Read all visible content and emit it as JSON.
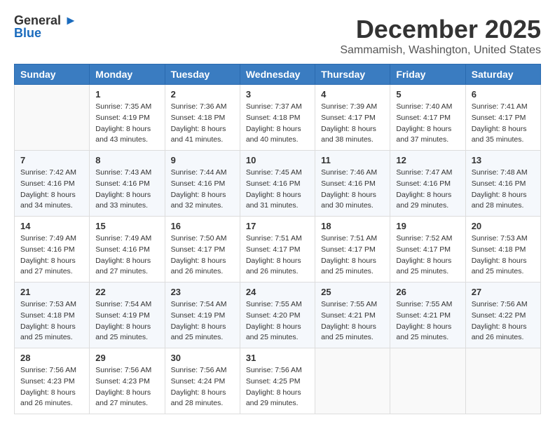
{
  "logo": {
    "general": "General",
    "blue": "Blue"
  },
  "title": "December 2025",
  "location": "Sammamish, Washington, United States",
  "days_of_week": [
    "Sunday",
    "Monday",
    "Tuesday",
    "Wednesday",
    "Thursday",
    "Friday",
    "Saturday"
  ],
  "weeks": [
    [
      {
        "day": "",
        "info": ""
      },
      {
        "day": "1",
        "info": "Sunrise: 7:35 AM\nSunset: 4:19 PM\nDaylight: 8 hours\nand 43 minutes."
      },
      {
        "day": "2",
        "info": "Sunrise: 7:36 AM\nSunset: 4:18 PM\nDaylight: 8 hours\nand 41 minutes."
      },
      {
        "day": "3",
        "info": "Sunrise: 7:37 AM\nSunset: 4:18 PM\nDaylight: 8 hours\nand 40 minutes."
      },
      {
        "day": "4",
        "info": "Sunrise: 7:39 AM\nSunset: 4:17 PM\nDaylight: 8 hours\nand 38 minutes."
      },
      {
        "day": "5",
        "info": "Sunrise: 7:40 AM\nSunset: 4:17 PM\nDaylight: 8 hours\nand 37 minutes."
      },
      {
        "day": "6",
        "info": "Sunrise: 7:41 AM\nSunset: 4:17 PM\nDaylight: 8 hours\nand 35 minutes."
      }
    ],
    [
      {
        "day": "7",
        "info": "Sunrise: 7:42 AM\nSunset: 4:16 PM\nDaylight: 8 hours\nand 34 minutes."
      },
      {
        "day": "8",
        "info": "Sunrise: 7:43 AM\nSunset: 4:16 PM\nDaylight: 8 hours\nand 33 minutes."
      },
      {
        "day": "9",
        "info": "Sunrise: 7:44 AM\nSunset: 4:16 PM\nDaylight: 8 hours\nand 32 minutes."
      },
      {
        "day": "10",
        "info": "Sunrise: 7:45 AM\nSunset: 4:16 PM\nDaylight: 8 hours\nand 31 minutes."
      },
      {
        "day": "11",
        "info": "Sunrise: 7:46 AM\nSunset: 4:16 PM\nDaylight: 8 hours\nand 30 minutes."
      },
      {
        "day": "12",
        "info": "Sunrise: 7:47 AM\nSunset: 4:16 PM\nDaylight: 8 hours\nand 29 minutes."
      },
      {
        "day": "13",
        "info": "Sunrise: 7:48 AM\nSunset: 4:16 PM\nDaylight: 8 hours\nand 28 minutes."
      }
    ],
    [
      {
        "day": "14",
        "info": "Sunrise: 7:49 AM\nSunset: 4:16 PM\nDaylight: 8 hours\nand 27 minutes."
      },
      {
        "day": "15",
        "info": "Sunrise: 7:49 AM\nSunset: 4:16 PM\nDaylight: 8 hours\nand 27 minutes."
      },
      {
        "day": "16",
        "info": "Sunrise: 7:50 AM\nSunset: 4:17 PM\nDaylight: 8 hours\nand 26 minutes."
      },
      {
        "day": "17",
        "info": "Sunrise: 7:51 AM\nSunset: 4:17 PM\nDaylight: 8 hours\nand 26 minutes."
      },
      {
        "day": "18",
        "info": "Sunrise: 7:51 AM\nSunset: 4:17 PM\nDaylight: 8 hours\nand 25 minutes."
      },
      {
        "day": "19",
        "info": "Sunrise: 7:52 AM\nSunset: 4:17 PM\nDaylight: 8 hours\nand 25 minutes."
      },
      {
        "day": "20",
        "info": "Sunrise: 7:53 AM\nSunset: 4:18 PM\nDaylight: 8 hours\nand 25 minutes."
      }
    ],
    [
      {
        "day": "21",
        "info": "Sunrise: 7:53 AM\nSunset: 4:18 PM\nDaylight: 8 hours\nand 25 minutes."
      },
      {
        "day": "22",
        "info": "Sunrise: 7:54 AM\nSunset: 4:19 PM\nDaylight: 8 hours\nand 25 minutes."
      },
      {
        "day": "23",
        "info": "Sunrise: 7:54 AM\nSunset: 4:19 PM\nDaylight: 8 hours\nand 25 minutes."
      },
      {
        "day": "24",
        "info": "Sunrise: 7:55 AM\nSunset: 4:20 PM\nDaylight: 8 hours\nand 25 minutes."
      },
      {
        "day": "25",
        "info": "Sunrise: 7:55 AM\nSunset: 4:21 PM\nDaylight: 8 hours\nand 25 minutes."
      },
      {
        "day": "26",
        "info": "Sunrise: 7:55 AM\nSunset: 4:21 PM\nDaylight: 8 hours\nand 25 minutes."
      },
      {
        "day": "27",
        "info": "Sunrise: 7:56 AM\nSunset: 4:22 PM\nDaylight: 8 hours\nand 26 minutes."
      }
    ],
    [
      {
        "day": "28",
        "info": "Sunrise: 7:56 AM\nSunset: 4:23 PM\nDaylight: 8 hours\nand 26 minutes."
      },
      {
        "day": "29",
        "info": "Sunrise: 7:56 AM\nSunset: 4:23 PM\nDaylight: 8 hours\nand 27 minutes."
      },
      {
        "day": "30",
        "info": "Sunrise: 7:56 AM\nSunset: 4:24 PM\nDaylight: 8 hours\nand 28 minutes."
      },
      {
        "day": "31",
        "info": "Sunrise: 7:56 AM\nSunset: 4:25 PM\nDaylight: 8 hours\nand 29 minutes."
      },
      {
        "day": "",
        "info": ""
      },
      {
        "day": "",
        "info": ""
      },
      {
        "day": "",
        "info": ""
      }
    ]
  ]
}
